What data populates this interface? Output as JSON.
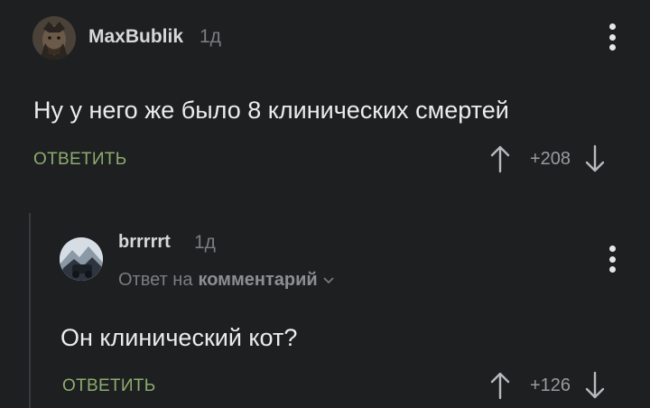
{
  "comments": [
    {
      "author": "MaxBublik",
      "time": "1д",
      "text": "Ну у него же было 8 клинических смертей",
      "reply_label": "ОТВЕТИТЬ",
      "score": "+208"
    },
    {
      "author": "brrrrrt",
      "time": "1д",
      "reply_to_prefix": "Ответ на",
      "reply_to_link": "комментарий",
      "text": "Он клинический кот?",
      "reply_label": "ОТВЕТИТЬ",
      "score": "+126"
    }
  ],
  "colors": {
    "background": "#1e1f21",
    "accent_green": "#8dac6e",
    "muted": "#7c7d80"
  },
  "icons": [
    "kebab-menu-icon",
    "upvote-arrow-icon",
    "downvote-arrow-icon",
    "chevron-down-icon"
  ]
}
